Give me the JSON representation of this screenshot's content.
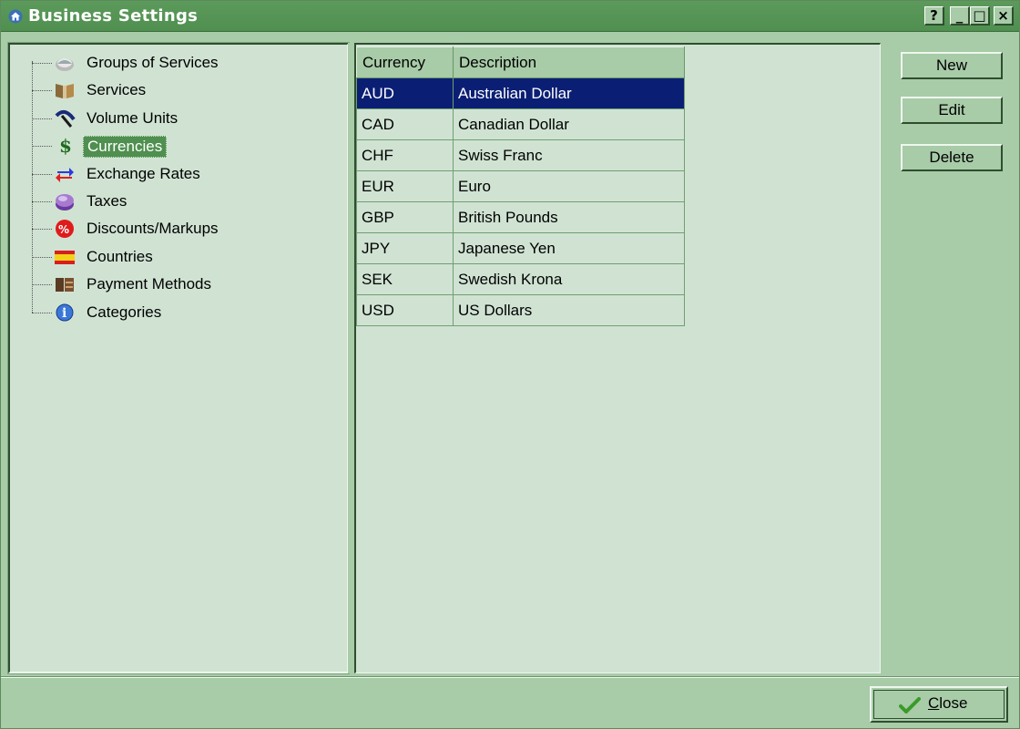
{
  "window": {
    "title": "Business Settings",
    "controls": {
      "help": "?",
      "minimize": "_",
      "maximize": "□",
      "close": "×"
    }
  },
  "tree": {
    "items": [
      {
        "label": "Groups of Services",
        "icon": "groups-icon",
        "selected": false
      },
      {
        "label": "Services",
        "icon": "services-icon",
        "selected": false
      },
      {
        "label": "Volume Units",
        "icon": "gauge-icon",
        "selected": false
      },
      {
        "label": "Currencies",
        "icon": "dollar-icon",
        "selected": true
      },
      {
        "label": "Exchange Rates",
        "icon": "exchange-arrows-icon",
        "selected": false
      },
      {
        "label": "Taxes",
        "icon": "taxes-icon",
        "selected": false
      },
      {
        "label": "Discounts/Markups",
        "icon": "percent-icon",
        "selected": false
      },
      {
        "label": "Countries",
        "icon": "flag-icon",
        "selected": false
      },
      {
        "label": "Payment Methods",
        "icon": "wallet-icon",
        "selected": false
      },
      {
        "label": "Categories",
        "icon": "info-icon",
        "selected": false
      }
    ]
  },
  "table": {
    "headers": [
      "Currency",
      "Description"
    ],
    "rows": [
      {
        "code": "AUD",
        "description": "Australian Dollar",
        "selected": true
      },
      {
        "code": "CAD",
        "description": "Canadian Dollar",
        "selected": false
      },
      {
        "code": "CHF",
        "description": "Swiss Franc",
        "selected": false
      },
      {
        "code": "EUR",
        "description": "Euro",
        "selected": false
      },
      {
        "code": "GBP",
        "description": "British Pounds",
        "selected": false
      },
      {
        "code": "JPY",
        "description": "Japanese Yen",
        "selected": false
      },
      {
        "code": "SEK",
        "description": "Swedish Krona",
        "selected": false
      },
      {
        "code": "USD",
        "description": "US Dollars",
        "selected": false
      }
    ]
  },
  "buttons": {
    "new": "New",
    "edit": "Edit",
    "delete": "Delete",
    "close_prefix": "C",
    "close_rest": "lose"
  },
  "colors": {
    "titlebar": "#4f8f4f",
    "panel_bg": "#d0e3d3",
    "window_bg": "#a8cba8",
    "selection": "#0a1f74"
  }
}
